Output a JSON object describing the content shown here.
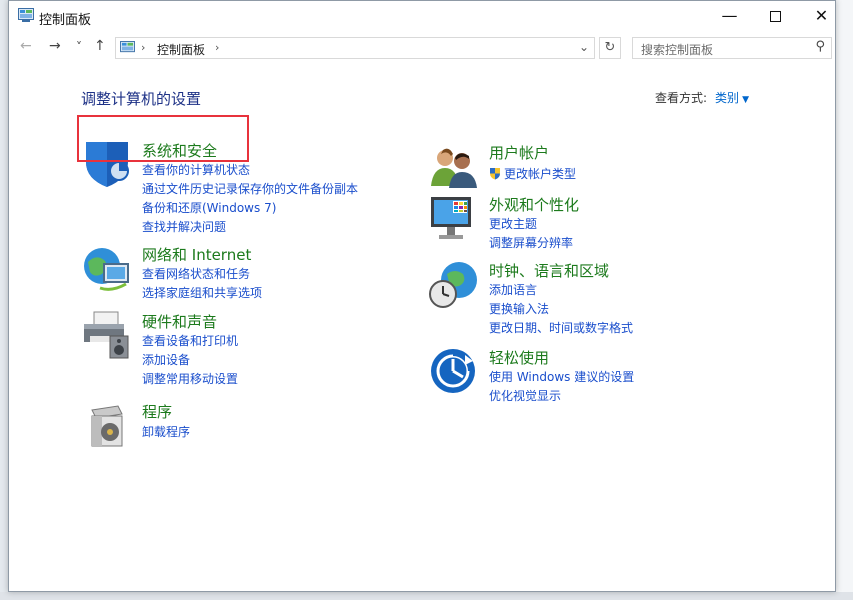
{
  "window": {
    "title": "控制面板"
  },
  "navbar": {
    "back_icon": "←",
    "forward_icon": "→",
    "recent_icon": "˅",
    "up_icon": "↑",
    "breadcrumb": "控制面板",
    "refresh_icon": "↻",
    "search_placeholder": "搜索控制面板"
  },
  "content": {
    "heading": "调整计算机的设置",
    "view_by_label": "查看方式:",
    "view_by_value": "类别"
  },
  "categories": [
    {
      "title": "系统和安全",
      "icon": "shield-icon",
      "links": [
        "查看你的计算机状态",
        "通过文件历史记录保存你的文件备份副本",
        "备份和还原(Windows 7)",
        "查找并解决问题"
      ]
    },
    {
      "title": "网络和 Internet",
      "icon": "network-globe-icon",
      "links": [
        "查看网络状态和任务",
        "选择家庭组和共享选项"
      ]
    },
    {
      "title": "硬件和声音",
      "icon": "printer-speaker-icon",
      "links": [
        "查看设备和打印机",
        "添加设备",
        "调整常用移动设置"
      ]
    },
    {
      "title": "程序",
      "icon": "programs-box-icon",
      "links": [
        "卸载程序"
      ]
    },
    {
      "title": "用户帐户",
      "icon": "users-icon",
      "links": [
        "更改帐户类型"
      ]
    },
    {
      "title": "外观和个性化",
      "icon": "monitor-icon",
      "links": [
        "更改主题",
        "调整屏幕分辨率"
      ]
    },
    {
      "title": "时钟、语言和区域",
      "icon": "clock-globe-icon",
      "links": [
        "添加语言",
        "更换输入法",
        "更改日期、时间或数字格式"
      ]
    },
    {
      "title": "轻松使用",
      "icon": "ease-of-access-icon",
      "links": [
        "使用 Windows 建议的设置",
        "优化视觉显示"
      ]
    }
  ]
}
